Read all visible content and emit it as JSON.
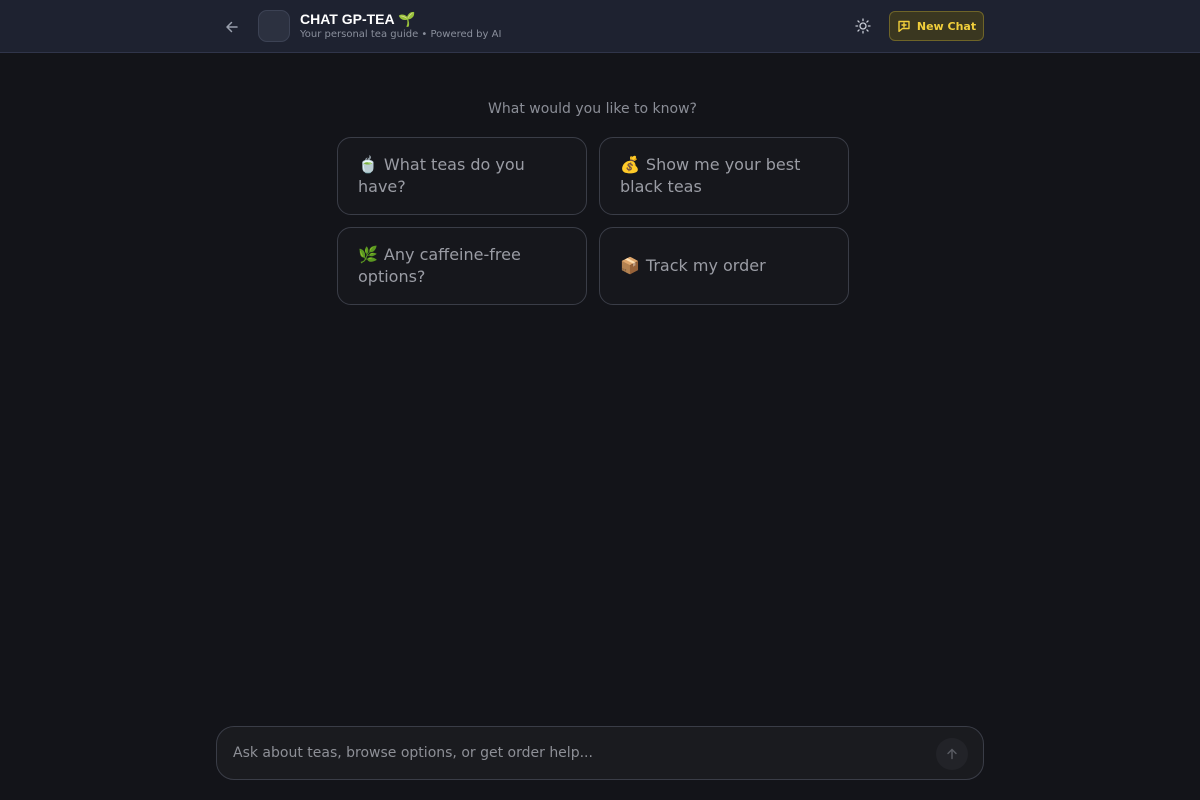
{
  "header": {
    "title": "CHAT GP-TEA",
    "title_emoji": "🌱",
    "subtitle": "Your personal tea guide • Powered by AI",
    "new_chat_label": "New Chat",
    "icons": {
      "back": "arrow-left-icon",
      "theme": "sun-icon",
      "new_chat": "message-plus-icon"
    }
  },
  "main": {
    "prompt": "What would you like to know?",
    "suggestions": [
      {
        "emoji": "🍵",
        "label": "What teas do you have?"
      },
      {
        "emoji": "💰",
        "label": "Show me your best black teas"
      },
      {
        "emoji": "🌿",
        "label": "Any caffeine-free options?"
      },
      {
        "emoji": "📦",
        "label": "Track my order"
      }
    ]
  },
  "composer": {
    "value": "",
    "placeholder": "Ask about teas, browse options, or get order help...",
    "send_icon": "arrow-up-icon"
  },
  "colors": {
    "background": "#131419",
    "header": "#1e2230",
    "accent": "#f1cf3b"
  }
}
